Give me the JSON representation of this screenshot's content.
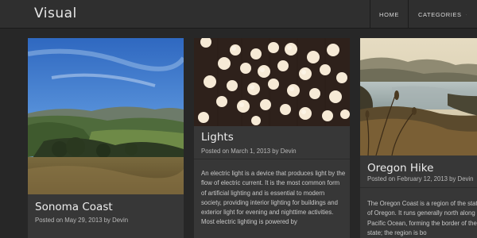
{
  "header": {
    "logo": "Visual",
    "nav": [
      {
        "label": "HOME"
      },
      {
        "label": "CATEGORIES"
      }
    ]
  },
  "cards": [
    {
      "title": "Sonoma Coast",
      "meta": "Posted on May 29, 2013 by Devin"
    },
    {
      "title": "Lights",
      "meta": "Posted on March 1, 2013 by Devin",
      "body": "An electric light is a device that produces light by the flow of electric current. It is the most common form of artificial lighting and is essential to modern society, providing interior lighting for buildings and exterior light for evening and nighttime activities. Most electric lighting is powered by"
    },
    {
      "title": "Oregon Hike",
      "meta": "Posted on February 12, 2013 by Devin",
      "body": "The Oregon Coast is a region of the state of Oregon. It runs generally north along the Pacific Ocean, forming the border of the state; the region is bo"
    }
  ],
  "colors": {
    "background": "#272727",
    "header": "#2f2f2f",
    "card": "#373737",
    "title": "#ededed",
    "meta": "#b9b9b9"
  }
}
